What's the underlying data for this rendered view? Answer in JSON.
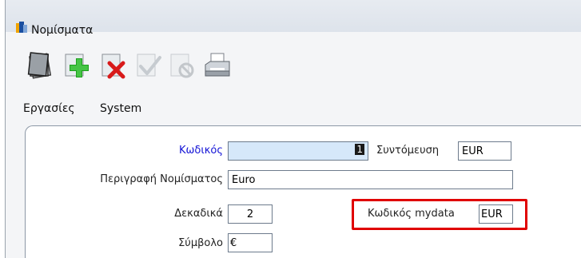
{
  "window": {
    "title": "Νομίσματα",
    "icon": "window-app-icon"
  },
  "toolbar": {
    "buttons": [
      {
        "name": "new-document-button",
        "icon": "document-stack-icon",
        "enabled": true
      },
      {
        "name": "add-button",
        "icon": "green-plus-icon",
        "enabled": true
      },
      {
        "name": "delete-button",
        "icon": "red-x-icon",
        "enabled": true
      },
      {
        "name": "confirm-button",
        "icon": "check-icon",
        "enabled": false
      },
      {
        "name": "cancel-button",
        "icon": "no-entry-icon",
        "enabled": false
      },
      {
        "name": "print-button",
        "icon": "printer-icon",
        "enabled": true
      }
    ]
  },
  "menu": {
    "tasks": "Εργασίες",
    "system": "System"
  },
  "form": {
    "code_label": "Κωδικός",
    "code_value": "1",
    "abbr_label": "Συντόμευση",
    "abbr_value": "EUR",
    "desc_label": "Περιγραφή Νομίσματος",
    "desc_value": "Euro",
    "decimals_label": "Δεκαδικά",
    "decimals_value": "2",
    "mydata_label": "Κωδικός mydata",
    "mydata_value": "EUR",
    "symbol_label": "Σύμβολο",
    "symbol_value": "€"
  },
  "colors": {
    "label_blue": "#1414d6",
    "highlight_red": "#e00000",
    "readonly_field": "#d6e8fa"
  }
}
